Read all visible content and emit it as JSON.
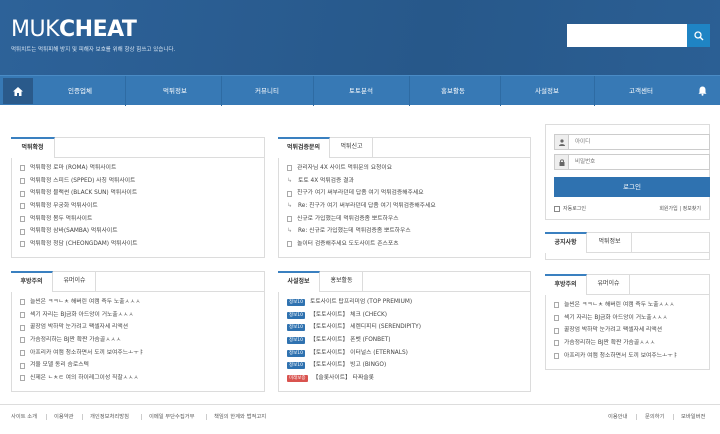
{
  "header": {
    "logo_light": "MUK",
    "logo_bold": "CHEAT",
    "tagline": "먹튀치트는 먹튀피해 방지 및 피해자 보호를 위해 항상 힘쓰고 있습니다.",
    "search_placeholder": ""
  },
  "nav": {
    "items": [
      "인증업체",
      "먹튀정보",
      "커뮤니티",
      "토토분석",
      "홍보활동",
      "사설정보",
      "고객센터"
    ]
  },
  "panel1": {
    "tab": "먹튀확정",
    "items": [
      "먹튀확정 로마 (ROMA) 먹튀사이트",
      "먹튀확정 스피드 (SPPED) 사칭 먹튀사이트",
      "먹튀확정 블랙썬 (BLACK SUN) 먹튀사이트",
      "먹튀확정 무궁화 먹튀사이트",
      "먹튀확정 봄두 먹튀사이트",
      "먹튀확정 삼바(SAMBA) 먹튀사이트",
      "먹튀확정 청담 (CHEONGDAM) 먹튀사이트"
    ]
  },
  "panel2": {
    "tabs": [
      "먹튀검증문의",
      "먹튀신고"
    ],
    "items": [
      "관리자님 4X 사이트 먹튀문의 요청이요",
      "토토 4X 먹튀검증 결과",
      "친구가 여기 써부라던데 답좀 여기 먹튀검증해주세요",
      "Re: 친구가 여기 써부라던데 답좀 여기 먹튀검증해주세요",
      "신규로 가입했는데 먹튀검증좀 뽀트하우스",
      "Re: 신규로 가입했는데 먹튀검증좀 뽀트하우스",
      "놀이터 검증해주세요 도도사이트 존스포츠"
    ]
  },
  "panel3": {
    "tabs": [
      "후방주의",
      "유머이슈"
    ],
    "items": [
      "늘씬은 ㅋㅋㄴㅊ 해버린 여캠 즉두 노출ㅅㅅㅅ",
      "섹기 자리는 BJ금화 아드앙이 거노출ㅅㅅㅅ",
      "꿀장엄 박하막 눈가려고 팩셀자세 리액션",
      "가슴정리하는 BJ짠 확짠 가슴골ㅅㅅㅅ",
      "아프리카 여캠 청소하면서 도끼 보여주느ㅗㅜㅑ",
      "겨울 모델 동리 슴로스텍",
      "신제은 ㄴㅊㅌ 여의 하이레그이성 직찰ㅅㅅㅅ"
    ]
  },
  "panel4": {
    "tabs": [
      "사설정보",
      "홍보활동"
    ],
    "items": [
      {
        "badge": "정보10",
        "text": "토토사이트 탑프리미엄 (TOP PREMIUM)",
        "red": false
      },
      {
        "badge": "정보10",
        "text": "【토토사이트】 체크 (CHECK)",
        "red": false
      },
      {
        "badge": "정보10",
        "text": "【토토사이트】 세렌디피티 (SERENDIPITY)",
        "red": false
      },
      {
        "badge": "정보10",
        "text": "【토토사이트】 폰벳 (FONBET)",
        "red": false
      },
      {
        "badge": "정보10",
        "text": "【토토사이트】 이터널스 (ETERNALS)",
        "red": false
      },
      {
        "badge": "정보10",
        "text": "【토토사이트】 빙고 (BINGO)",
        "red": false
      },
      {
        "badge": "미래보증",
        "text": "【슬롯사이트】 타짜슬롯",
        "red": true
      }
    ]
  },
  "login": {
    "id_placeholder": "아이디",
    "pw_placeholder": "비밀번호",
    "button": "로그인",
    "auto_login": "자동로그인",
    "links": "회원가입 | 정보찾기"
  },
  "panel_notice": {
    "tabs": [
      "공지사항",
      "먹튀정보"
    ]
  },
  "panel5": {
    "tabs": [
      "후방주의",
      "유머이슈"
    ],
    "items": [
      "늘씬은 ㅋㅋㄴㅊ 해버린 여캠 즉두 노출ㅅㅅㅅ",
      "섹기 자리는 BJ금화 아드앙이 거노출ㅅㅅㅅ",
      "꿀장엄 박하막 눈가려고 팩셀자세 리액션",
      "가슴정리하는 BJ짠 확짠 가슴골ㅅㅅㅅ",
      "아프리카 여캠 청소하면서 도끼 보여주느ㅗㅜㅑ"
    ]
  },
  "footer": {
    "left": [
      "사이트 소개",
      "이용약관",
      "개인정보처리방침",
      "이메일 무단수집거부",
      "책임의 한계와 법적고지"
    ],
    "right": [
      "이용안내",
      "문의하기",
      "모바일버전"
    ]
  }
}
